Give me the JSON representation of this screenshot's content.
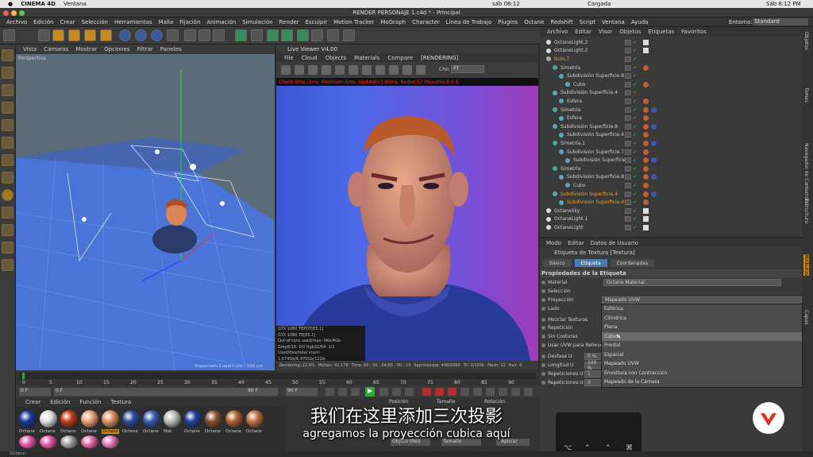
{
  "mac_menubar": {
    "app_name": "CINEMA 4D",
    "menu": "Ventana",
    "clock_short": "sáb 08:12",
    "battery": "Cargada",
    "clock_long": "Sáb 8:12 PM"
  },
  "window": {
    "title": "RENDER PERSONAJE 1.c4d * - Principal"
  },
  "main_menu": [
    "Archivo",
    "Edición",
    "Crear",
    "Selección",
    "Herramientas",
    "Malla",
    "Fijación",
    "Animación",
    "Simulación",
    "Render",
    "Esculpir",
    "Motion Tracker",
    "MoGraph",
    "Character",
    "Línea de Trabajo",
    "Plugins",
    "Octane",
    "Redshift",
    "Script",
    "Ventana",
    "Ayuda"
  ],
  "layout": {
    "label": "Entorno:",
    "value": "Standard"
  },
  "viewport": {
    "menu": [
      "Vista",
      "Cámaras",
      "Mostrar",
      "Opciones",
      "Filtrar",
      "Paneles"
    ],
    "label": "Perspectiva",
    "grid_text": "Espaciado Cuadrícula : 100 cm"
  },
  "live_viewer": {
    "title": "Live Viewer V4.00",
    "menu": [
      "File",
      "Cloud",
      "Objects",
      "Materials",
      "Compare",
      "[RENDERING]"
    ],
    "channel_label": "Chn:",
    "channel_value": "PT",
    "status_line": "Check:0ms./1ms. MeshGen:0ms. Update[C]:90ms. Nodes:57 Movable:8  0 0",
    "gpu_info": [
      "GTX 1080 TEPDT[E5.1]",
      "GTX 1080 TE[E5.1]",
      "Out-of-core used/max: 0Kb/4Gb",
      "Grey8/16: 0/0      Rgb32/64: 1/1",
      "Used/free/total vram: 1.074Gb/6.470Gb/11Gb"
    ],
    "bottom": [
      "Rendering: 22.4%",
      "Ms/sec: 41.178",
      "Time: 00 : 00 : 04/00 : 00 : 19",
      "Spp/maxspp: 448/2000",
      "Tri: 0/103k",
      "Mesh: 12",
      "Hair: 0"
    ]
  },
  "timeline": {
    "ticks": [
      "0",
      "5",
      "10",
      "15",
      "20",
      "25",
      "30",
      "35",
      "40",
      "45",
      "50",
      "55",
      "60",
      "65",
      "70",
      "75",
      "80",
      "85",
      "90"
    ],
    "current_frame": "0 F",
    "start": "0 F",
    "end_a": "90 F",
    "end_b": "90 F"
  },
  "materials": {
    "menu": [
      "Crear",
      "Edición",
      "Función",
      "Textura"
    ],
    "row1": [
      {
        "label": "Octane",
        "color": "#1a3a9a"
      },
      {
        "label": "Octane",
        "color": "#e0e0e0"
      },
      {
        "label": "Octane",
        "color": "#c03a18"
      },
      {
        "label": "Octane",
        "color": "#e8a070"
      },
      {
        "label": "Octane",
        "color": "#d89060"
      },
      {
        "label": "Octane",
        "color": "#2a4a9a"
      },
      {
        "label": "Octane",
        "color": "#3a5ab0"
      },
      {
        "label": "Mat",
        "color": "#bbbbbb"
      },
      {
        "label": "Octane",
        "color": "#2040a0"
      },
      {
        "label": "Octane",
        "color": "#8a5030"
      },
      {
        "label": "Octane",
        "color": "#b06030"
      },
      {
        "label": "Octane",
        "color": "#c07040"
      }
    ],
    "row2_colors": [
      "#e050a0",
      "#e050a0",
      "#999999",
      "#e060a0",
      "#e070b0"
    ]
  },
  "coords": {
    "headers": [
      "Posición",
      "Tamaño",
      "Rotación"
    ],
    "apply": "Aplicar",
    "mode": "Objeto (Rel)",
    "size_mode": "Tamaño"
  },
  "object_manager": {
    "menu": [
      "Archivo",
      "Editar",
      "Visor",
      "Objetos",
      "Etiquetas",
      "Favoritos"
    ],
    "rows": [
      {
        "name": "OctaneLight.3",
        "indent": 0,
        "sel": false
      },
      {
        "name": "OctaneLight.2",
        "indent": 0,
        "sel": false
      },
      {
        "name": "Nulo.7",
        "indent": 0,
        "sel": true
      },
      {
        "name": "Simetría",
        "indent": 1,
        "sel": false
      },
      {
        "name": "Subdivisión Superficie.8",
        "indent": 2,
        "sel": false
      },
      {
        "name": "Cubo",
        "indent": 3,
        "sel": false
      },
      {
        "name": "Subdivisión Superficie.4",
        "indent": 1,
        "sel": false
      },
      {
        "name": "Esfera",
        "indent": 2,
        "sel": false
      },
      {
        "name": "Simetría",
        "indent": 1,
        "sel": false
      },
      {
        "name": "Esfera",
        "indent": 2,
        "sel": false
      },
      {
        "name": "Subdivisión Superficie.8",
        "indent": 1,
        "sel": false
      },
      {
        "name": "Subdivisión Superficie.4",
        "indent": 2,
        "sel": false
      },
      {
        "name": "Simetría.1",
        "indent": 1,
        "sel": false
      },
      {
        "name": "Subdivisión Superficie.7",
        "indent": 2,
        "sel": false
      },
      {
        "name": "Subdivisión Superficie.6",
        "indent": 3,
        "sel": false
      },
      {
        "name": "Simetría",
        "indent": 1,
        "sel": false
      },
      {
        "name": "Subdivisión Superficie.8",
        "indent": 2,
        "sel": false
      },
      {
        "name": "Cubo",
        "indent": 3,
        "sel": false
      },
      {
        "name": "Subdivisión Superficie.4",
        "indent": 1,
        "sel": true
      },
      {
        "name": "Subdivisión Superficie.4",
        "indent": 2,
        "sel": true
      },
      {
        "name": "OctaneSky",
        "indent": 0,
        "sel": false
      },
      {
        "name": "OctaneLight.1",
        "indent": 0,
        "sel": false
      },
      {
        "name": "OctaneLight",
        "indent": 0,
        "sel": false
      }
    ]
  },
  "attributes": {
    "menu": [
      "Modo",
      "Editar",
      "Datos de Usuario"
    ],
    "header": "Etiqueta de Textura [Textura]",
    "tabs": [
      "Básico",
      "Etiqueta",
      "Coordenadas"
    ],
    "section": "Propiedades de la Etiqueta",
    "material_label": "Material",
    "material_value": "Octane Material",
    "selection_label": "Selección",
    "projection_label": "Proyección",
    "projection_value": "Mapeado UVW",
    "side_label": "Lado",
    "mix_label": "Mezclar Texturas",
    "repeat_label": "Repetición",
    "seams_label": "Sin Costuras",
    "uvw_label": "Usar UVW para Relieve",
    "offset_u": "Desfase U",
    "offset_u_val": "0 %",
    "length_u": "Longitud U",
    "length_u_val": "100 %",
    "tiles_u": "Repeticiones U",
    "tiles_u_val": "1",
    "tiles_u2": "Repeticiones U",
    "tiles_u2_val": "0",
    "dropdown": [
      "Esférica",
      "Cilíndrica",
      "Plana",
      "Cúbica",
      "Frontal",
      "Espacial",
      "Mapeado UVW",
      "Envoltura con Contracción",
      "Mapeado de la Cámara"
    ]
  },
  "right_tabs": [
    "Objetos",
    "Tomas",
    "Navegador de Contenido",
    "Estructura",
    "Atributos",
    "Capas"
  ],
  "subtitles": {
    "zh": "我们在这里添加三次投影",
    "es": "agregamos la proyección cubica aquí"
  },
  "statusbar": "Octane:"
}
